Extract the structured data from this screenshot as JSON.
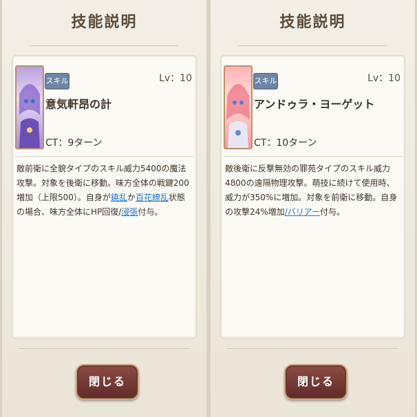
{
  "left": {
    "title": "技能説明",
    "badge": "スキル",
    "level": "Lv：10",
    "skill_name": "意気軒昂の計",
    "ct": "CT：9ターン",
    "desc_line1": "敵前衛に全貌タイプのスキル威力5400の魔法攻撃。対象を後衛に移動。味方",
    "desc_line2": "全体の戦鍵200増加（上限500）。自身が",
    "desc_link1": "鐃乱",
    "desc_mid": "か",
    "desc_link2": "百花繚乱",
    "desc_line2_end": "状態の場合、味方全",
    "desc_line3_start": "体にHP回復/",
    "desc_link3": "浸張",
    "desc_line3_end": "付与。",
    "close_label": "閉じる"
  },
  "right": {
    "title": "技能説明",
    "badge": "スキル",
    "level": "Lv：10",
    "skill_name": "アンドゥラ・ヨーゲット",
    "ct": "CT：10ターン",
    "desc_line1": "敵後衛に反撃無効の罪苑タイプのスキル威力4800の遠隔物理攻撃。萌技に続",
    "desc_line2": "けて使用時、威力が350%に増加。対象を前衛に移動。自身の攻撃24%増加",
    "desc_link1": "/バリアー",
    "desc_line3_end": "付与。",
    "close_label": "閉じる"
  }
}
